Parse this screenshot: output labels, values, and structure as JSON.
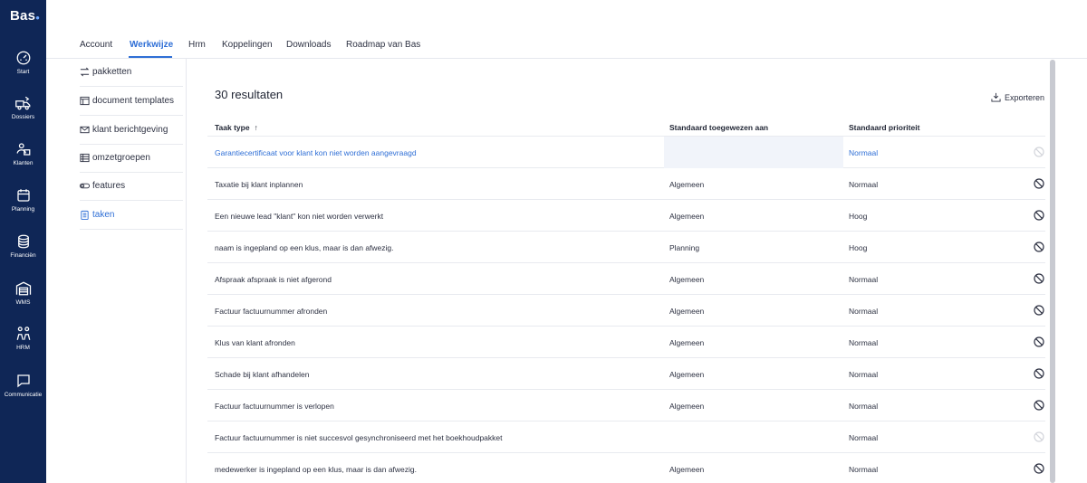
{
  "app": {
    "logo": "Bas",
    "logo_dot": "●"
  },
  "sidebar": {
    "items": [
      {
        "label": "Start",
        "icon": "gauge-icon"
      },
      {
        "label": "Dossiers",
        "icon": "truck-icon"
      },
      {
        "label": "Klanten",
        "icon": "customers-icon"
      },
      {
        "label": "Planning",
        "icon": "calendar-icon"
      },
      {
        "label": "Financiën",
        "icon": "coins-icon"
      },
      {
        "label": "WMS",
        "icon": "warehouse-icon"
      },
      {
        "label": "HRM",
        "icon": "people-icon"
      },
      {
        "label": "Communicatie",
        "icon": "chat-icon"
      }
    ]
  },
  "tabs": [
    {
      "label": "Account"
    },
    {
      "label": "Werkwijze",
      "active": true
    },
    {
      "label": "Hrm"
    },
    {
      "label": "Koppelingen"
    },
    {
      "label": "Downloads"
    },
    {
      "label": "Roadmap van Bas"
    }
  ],
  "subnav": [
    {
      "label": "pakketten",
      "icon": "arrows-icon"
    },
    {
      "label": "document templates",
      "icon": "template-icon"
    },
    {
      "label": "klant berichtgeving",
      "icon": "mail-icon"
    },
    {
      "label": "omzetgroepen",
      "icon": "table-icon"
    },
    {
      "label": "features",
      "icon": "toggle-icon"
    },
    {
      "label": "taken",
      "icon": "clipboard-icon",
      "active": true
    }
  ],
  "main": {
    "results": "30 resultaten",
    "export_label": "Exporteren",
    "columns": {
      "task_type": "Taak type",
      "sort_indicator": "↑",
      "assigned_to": "Standaard toegewezen aan",
      "priority": "Standaard prioriteit"
    },
    "rows": [
      {
        "task": "Garantiecertificaat voor klant kon niet worden aangevraagd",
        "assigned": "",
        "priority": "Normaal",
        "link": true,
        "icon_disabled": true
      },
      {
        "task": "Taxatie bij klant inplannen",
        "assigned": "Algemeen",
        "priority": "Normaal"
      },
      {
        "task": "Een nieuwe lead \"klant\" kon niet worden verwerkt",
        "assigned": "Algemeen",
        "priority": "Hoog"
      },
      {
        "task": "naam is ingepland op een klus, maar is dan afwezig.",
        "assigned": "Planning",
        "priority": "Hoog"
      },
      {
        "task": "Afspraak afspraak is niet afgerond",
        "assigned": "Algemeen",
        "priority": "Normaal"
      },
      {
        "task": "Factuur factuurnummer afronden",
        "assigned": "Algemeen",
        "priority": "Normaal"
      },
      {
        "task": "Klus van klant afronden",
        "assigned": "Algemeen",
        "priority": "Normaal"
      },
      {
        "task": "Schade bij klant afhandelen",
        "assigned": "Algemeen",
        "priority": "Normaal"
      },
      {
        "task": "Factuur factuurnummer is verlopen",
        "assigned": "Algemeen",
        "priority": "Normaal"
      },
      {
        "task": "Factuur factuurnummer is niet succesvol gesynchroniseerd met het boekhoudpakket",
        "assigned": "",
        "priority": "Normaal",
        "icon_disabled": true
      },
      {
        "task": "medewerker is ingepland op een klus, maar is dan afwezig.",
        "assigned": "Algemeen",
        "priority": "Normaal"
      }
    ]
  },
  "colors": {
    "sidebar": "#0f2656",
    "accent": "#2f6fd6",
    "highlight": "#f1f4fa"
  }
}
